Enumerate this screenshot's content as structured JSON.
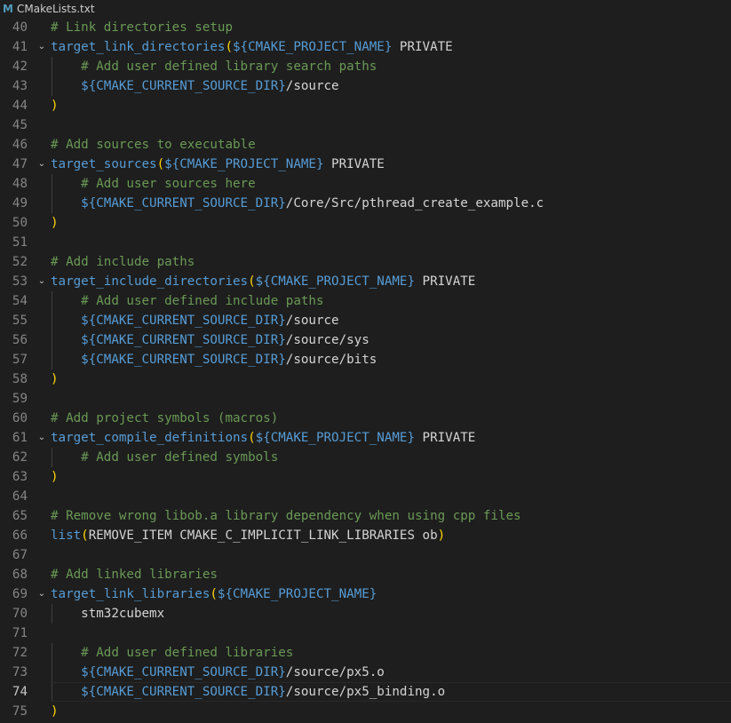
{
  "tab": {
    "filename": "CMakeLists.txt",
    "icon": "cmake-m-icon",
    "icon_glyph": "M"
  },
  "colors": {
    "background": "#1e1e1e",
    "comment": "#6a9955",
    "function": "#569cd6",
    "bracket": "#ffd700",
    "text": "#d4d4d4",
    "line_number": "#858585"
  },
  "current_line": 74,
  "lines": [
    {
      "n": "40",
      "fold": "",
      "indent": "",
      "tokens": [
        [
          "cmt",
          "# Link directories setup"
        ]
      ]
    },
    {
      "n": "41",
      "fold": "⌄",
      "indent": "",
      "tokens": [
        [
          "fn",
          "target_link_directories"
        ],
        [
          "paren",
          "("
        ],
        [
          "var",
          "${CMAKE_PROJECT_NAME}"
        ],
        [
          "plain",
          " PRIVATE"
        ]
      ]
    },
    {
      "n": "42",
      "fold": "",
      "indent": "    ",
      "tokens": [
        [
          "cmt",
          "# Add user defined library search paths"
        ]
      ]
    },
    {
      "n": "43",
      "fold": "",
      "indent": "    ",
      "tokens": [
        [
          "var",
          "${CMAKE_CURRENT_SOURCE_DIR}"
        ],
        [
          "plain",
          "/source"
        ]
      ]
    },
    {
      "n": "44",
      "fold": "",
      "indent": "",
      "tokens": [
        [
          "paren",
          ")"
        ]
      ]
    },
    {
      "n": "45",
      "fold": "",
      "indent": "",
      "tokens": []
    },
    {
      "n": "46",
      "fold": "",
      "indent": "",
      "tokens": [
        [
          "cmt",
          "# Add sources to executable"
        ]
      ]
    },
    {
      "n": "47",
      "fold": "⌄",
      "indent": "",
      "tokens": [
        [
          "fn",
          "target_sources"
        ],
        [
          "paren",
          "("
        ],
        [
          "var",
          "${CMAKE_PROJECT_NAME}"
        ],
        [
          "plain",
          " PRIVATE"
        ]
      ]
    },
    {
      "n": "48",
      "fold": "",
      "indent": "    ",
      "tokens": [
        [
          "cmt",
          "# Add user sources here"
        ]
      ]
    },
    {
      "n": "49",
      "fold": "",
      "indent": "    ",
      "tokens": [
        [
          "var",
          "${CMAKE_CURRENT_SOURCE_DIR}"
        ],
        [
          "plain",
          "/Core/Src/pthread_create_example.c"
        ]
      ]
    },
    {
      "n": "50",
      "fold": "",
      "indent": "",
      "tokens": [
        [
          "paren",
          ")"
        ]
      ]
    },
    {
      "n": "51",
      "fold": "",
      "indent": "",
      "tokens": []
    },
    {
      "n": "52",
      "fold": "",
      "indent": "",
      "tokens": [
        [
          "cmt",
          "# Add include paths"
        ]
      ]
    },
    {
      "n": "53",
      "fold": "⌄",
      "indent": "",
      "tokens": [
        [
          "fn",
          "target_include_directories"
        ],
        [
          "paren",
          "("
        ],
        [
          "var",
          "${CMAKE_PROJECT_NAME}"
        ],
        [
          "plain",
          " PRIVATE"
        ]
      ]
    },
    {
      "n": "54",
      "fold": "",
      "indent": "    ",
      "tokens": [
        [
          "cmt",
          "# Add user defined include paths"
        ]
      ]
    },
    {
      "n": "55",
      "fold": "",
      "indent": "    ",
      "tokens": [
        [
          "var",
          "${CMAKE_CURRENT_SOURCE_DIR}"
        ],
        [
          "plain",
          "/source"
        ]
      ]
    },
    {
      "n": "56",
      "fold": "",
      "indent": "    ",
      "tokens": [
        [
          "var",
          "${CMAKE_CURRENT_SOURCE_DIR}"
        ],
        [
          "plain",
          "/source/sys"
        ]
      ]
    },
    {
      "n": "57",
      "fold": "",
      "indent": "    ",
      "tokens": [
        [
          "var",
          "${CMAKE_CURRENT_SOURCE_DIR}"
        ],
        [
          "plain",
          "/source/bits"
        ]
      ]
    },
    {
      "n": "58",
      "fold": "",
      "indent": "",
      "tokens": [
        [
          "paren",
          ")"
        ]
      ]
    },
    {
      "n": "59",
      "fold": "",
      "indent": "",
      "tokens": []
    },
    {
      "n": "60",
      "fold": "",
      "indent": "",
      "tokens": [
        [
          "cmt",
          "# Add project symbols (macros)"
        ]
      ]
    },
    {
      "n": "61",
      "fold": "⌄",
      "indent": "",
      "tokens": [
        [
          "fn",
          "target_compile_definitions"
        ],
        [
          "paren",
          "("
        ],
        [
          "var",
          "${CMAKE_PROJECT_NAME}"
        ],
        [
          "plain",
          " PRIVATE"
        ]
      ]
    },
    {
      "n": "62",
      "fold": "",
      "indent": "    ",
      "tokens": [
        [
          "cmt",
          "# Add user defined symbols"
        ]
      ]
    },
    {
      "n": "63",
      "fold": "",
      "indent": "",
      "tokens": [
        [
          "paren",
          ")"
        ]
      ]
    },
    {
      "n": "64",
      "fold": "",
      "indent": "",
      "tokens": []
    },
    {
      "n": "65",
      "fold": "",
      "indent": "",
      "tokens": [
        [
          "cmt",
          "# Remove wrong libob.a library dependency when using cpp files"
        ]
      ]
    },
    {
      "n": "66",
      "fold": "",
      "indent": "",
      "tokens": [
        [
          "fn",
          "list"
        ],
        [
          "paren",
          "("
        ],
        [
          "plain",
          "REMOVE_ITEM CMAKE_C_IMPLICIT_LINK_LIBRARIES ob"
        ],
        [
          "paren",
          ")"
        ]
      ]
    },
    {
      "n": "67",
      "fold": "",
      "indent": "",
      "tokens": []
    },
    {
      "n": "68",
      "fold": "",
      "indent": "",
      "tokens": [
        [
          "cmt",
          "# Add linked libraries"
        ]
      ]
    },
    {
      "n": "69",
      "fold": "⌄",
      "indent": "",
      "tokens": [
        [
          "fn",
          "target_link_libraries"
        ],
        [
          "paren",
          "("
        ],
        [
          "var",
          "${CMAKE_PROJECT_NAME}"
        ]
      ]
    },
    {
      "n": "70",
      "fold": "",
      "indent": "    ",
      "tokens": [
        [
          "plain",
          "stm32cubemx"
        ]
      ]
    },
    {
      "n": "71",
      "fold": "",
      "indent": "",
      "tokens": []
    },
    {
      "n": "72",
      "fold": "",
      "indent": "    ",
      "tokens": [
        [
          "cmt",
          "# Add user defined libraries"
        ]
      ]
    },
    {
      "n": "73",
      "fold": "",
      "indent": "    ",
      "tokens": [
        [
          "var",
          "${CMAKE_CURRENT_SOURCE_DIR}"
        ],
        [
          "plain",
          "/source/px5.o"
        ]
      ]
    },
    {
      "n": "74",
      "fold": "",
      "indent": "    ",
      "tokens": [
        [
          "var",
          "${CMAKE_CURRENT_SOURCE_DIR}"
        ],
        [
          "plain",
          "/source/px5_binding.o"
        ]
      ]
    },
    {
      "n": "75",
      "fold": "",
      "indent": "",
      "tokens": [
        [
          "paren",
          ")"
        ]
      ]
    }
  ]
}
